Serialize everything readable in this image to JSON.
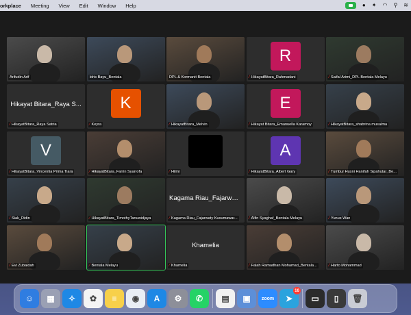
{
  "menubar": {
    "app_name": "orkplace",
    "items": [
      "Meeting",
      "View",
      "Edit",
      "Window",
      "Help"
    ]
  },
  "tiles": [
    {
      "name": "Arifudin Arif",
      "muted": false,
      "kind": "video"
    },
    {
      "name": "Idris Bayu_Bentala",
      "muted": false,
      "kind": "video"
    },
    {
      "name": "DPL & Kormanit Bentala",
      "muted": false,
      "kind": "video"
    },
    {
      "name": "HikayatBitara_Rahmadani",
      "muted": true,
      "kind": "avatar",
      "letter": "R",
      "color": "#c2185b"
    },
    {
      "name": "Saifal Arimi_DPL Bentala Melayu",
      "muted": true,
      "kind": "video"
    },
    {
      "name": "HikayatBitara_Raya Satria",
      "muted": true,
      "kind": "text",
      "display": "Hikayat Bitara_Raya S..."
    },
    {
      "name": "Keyra",
      "muted": true,
      "kind": "avatar",
      "letter": "K",
      "color": "#e65100"
    },
    {
      "name": "HikayatBitara_Melvin",
      "muted": true,
      "kind": "video"
    },
    {
      "name": "Hikayat Bitara_Emanuella Karamoy",
      "muted": true,
      "kind": "avatar",
      "letter": "E",
      "color": "#c2185b"
    },
    {
      "name": "HikayatBitara_shabrina musalma",
      "muted": true,
      "kind": "video"
    },
    {
      "name": "HikayatBitara_Vincentia Prima Tiara",
      "muted": true,
      "kind": "avatar",
      "letter": "V",
      "color": "#455a64"
    },
    {
      "name": "HikayatBitara_Farrin Syarrofa",
      "muted": true,
      "kind": "video"
    },
    {
      "name": "Hilmi",
      "muted": true,
      "kind": "black"
    },
    {
      "name": "HikayatBitara_Albert Gary",
      "muted": true,
      "kind": "avatar",
      "letter": "A",
      "color": "#5e35b1"
    },
    {
      "name": "Tumbur Husni Hanifah Sipahutar_Be...",
      "muted": true,
      "kind": "video"
    },
    {
      "name": "Siak_Didin",
      "muted": true,
      "kind": "video"
    },
    {
      "name": "HikayatBitara_TimothyTanuwidjaya",
      "muted": true,
      "kind": "video"
    },
    {
      "name": "Kagama Riau_Fajarwaty Kusumawar...",
      "muted": true,
      "kind": "text",
      "display": "Kagama Riau_Fajarwat..."
    },
    {
      "name": "Alfin Syaghaf_Bentala Melayu",
      "muted": true,
      "kind": "video"
    },
    {
      "name": "Yunus Wan",
      "muted": true,
      "kind": "video"
    },
    {
      "name": "Evi Zubaidah",
      "muted": true,
      "kind": "video"
    },
    {
      "name": "Bentala Melayu",
      "muted": true,
      "kind": "video",
      "active": true
    },
    {
      "name": "Khamelia",
      "muted": true,
      "kind": "text",
      "display": "Khamelia"
    },
    {
      "name": "Falah Ramadhan Mohamad_Bentala...",
      "muted": true,
      "kind": "video"
    },
    {
      "name": "Harto Mohammad",
      "muted": true,
      "kind": "video"
    }
  ],
  "dock": {
    "apps": [
      {
        "name": "finder",
        "color": "#2f7de1",
        "glyph": "☺"
      },
      {
        "name": "launchpad",
        "color": "#9aa0b4",
        "glyph": "▦"
      },
      {
        "name": "safari",
        "color": "#1e88e5",
        "glyph": "✧"
      },
      {
        "name": "photos",
        "color": "#f4f4f4",
        "glyph": "✿"
      },
      {
        "name": "notes",
        "color": "#f7d04a",
        "glyph": "≡"
      },
      {
        "name": "chrome",
        "color": "#e9eef5",
        "glyph": "◉"
      },
      {
        "name": "app-store",
        "color": "#1e88e5",
        "glyph": "A"
      },
      {
        "name": "system-settings",
        "color": "#8d8f99",
        "glyph": "⚙"
      },
      {
        "name": "whatsapp",
        "color": "#25d366",
        "glyph": "✆"
      },
      {
        "name": "sep",
        "color": "",
        "glyph": ""
      },
      {
        "name": "numbers",
        "color": "#f2f2f2",
        "glyph": "▤"
      },
      {
        "name": "preview",
        "color": "#5d8fd8",
        "glyph": "▣"
      },
      {
        "name": "zoom",
        "color": "#2d8cff",
        "glyph": "zoom"
      },
      {
        "name": "telegram",
        "color": "#2aa3de",
        "glyph": "➤",
        "badge": "16"
      },
      {
        "name": "sep",
        "color": "",
        "glyph": ""
      },
      {
        "name": "camera-window",
        "color": "#2b2b2b",
        "glyph": "▭"
      },
      {
        "name": "document",
        "color": "#3a3a3a",
        "glyph": "▯"
      },
      {
        "name": "trash",
        "color": "#c9ccd4",
        "glyph": "🗑"
      }
    ]
  }
}
